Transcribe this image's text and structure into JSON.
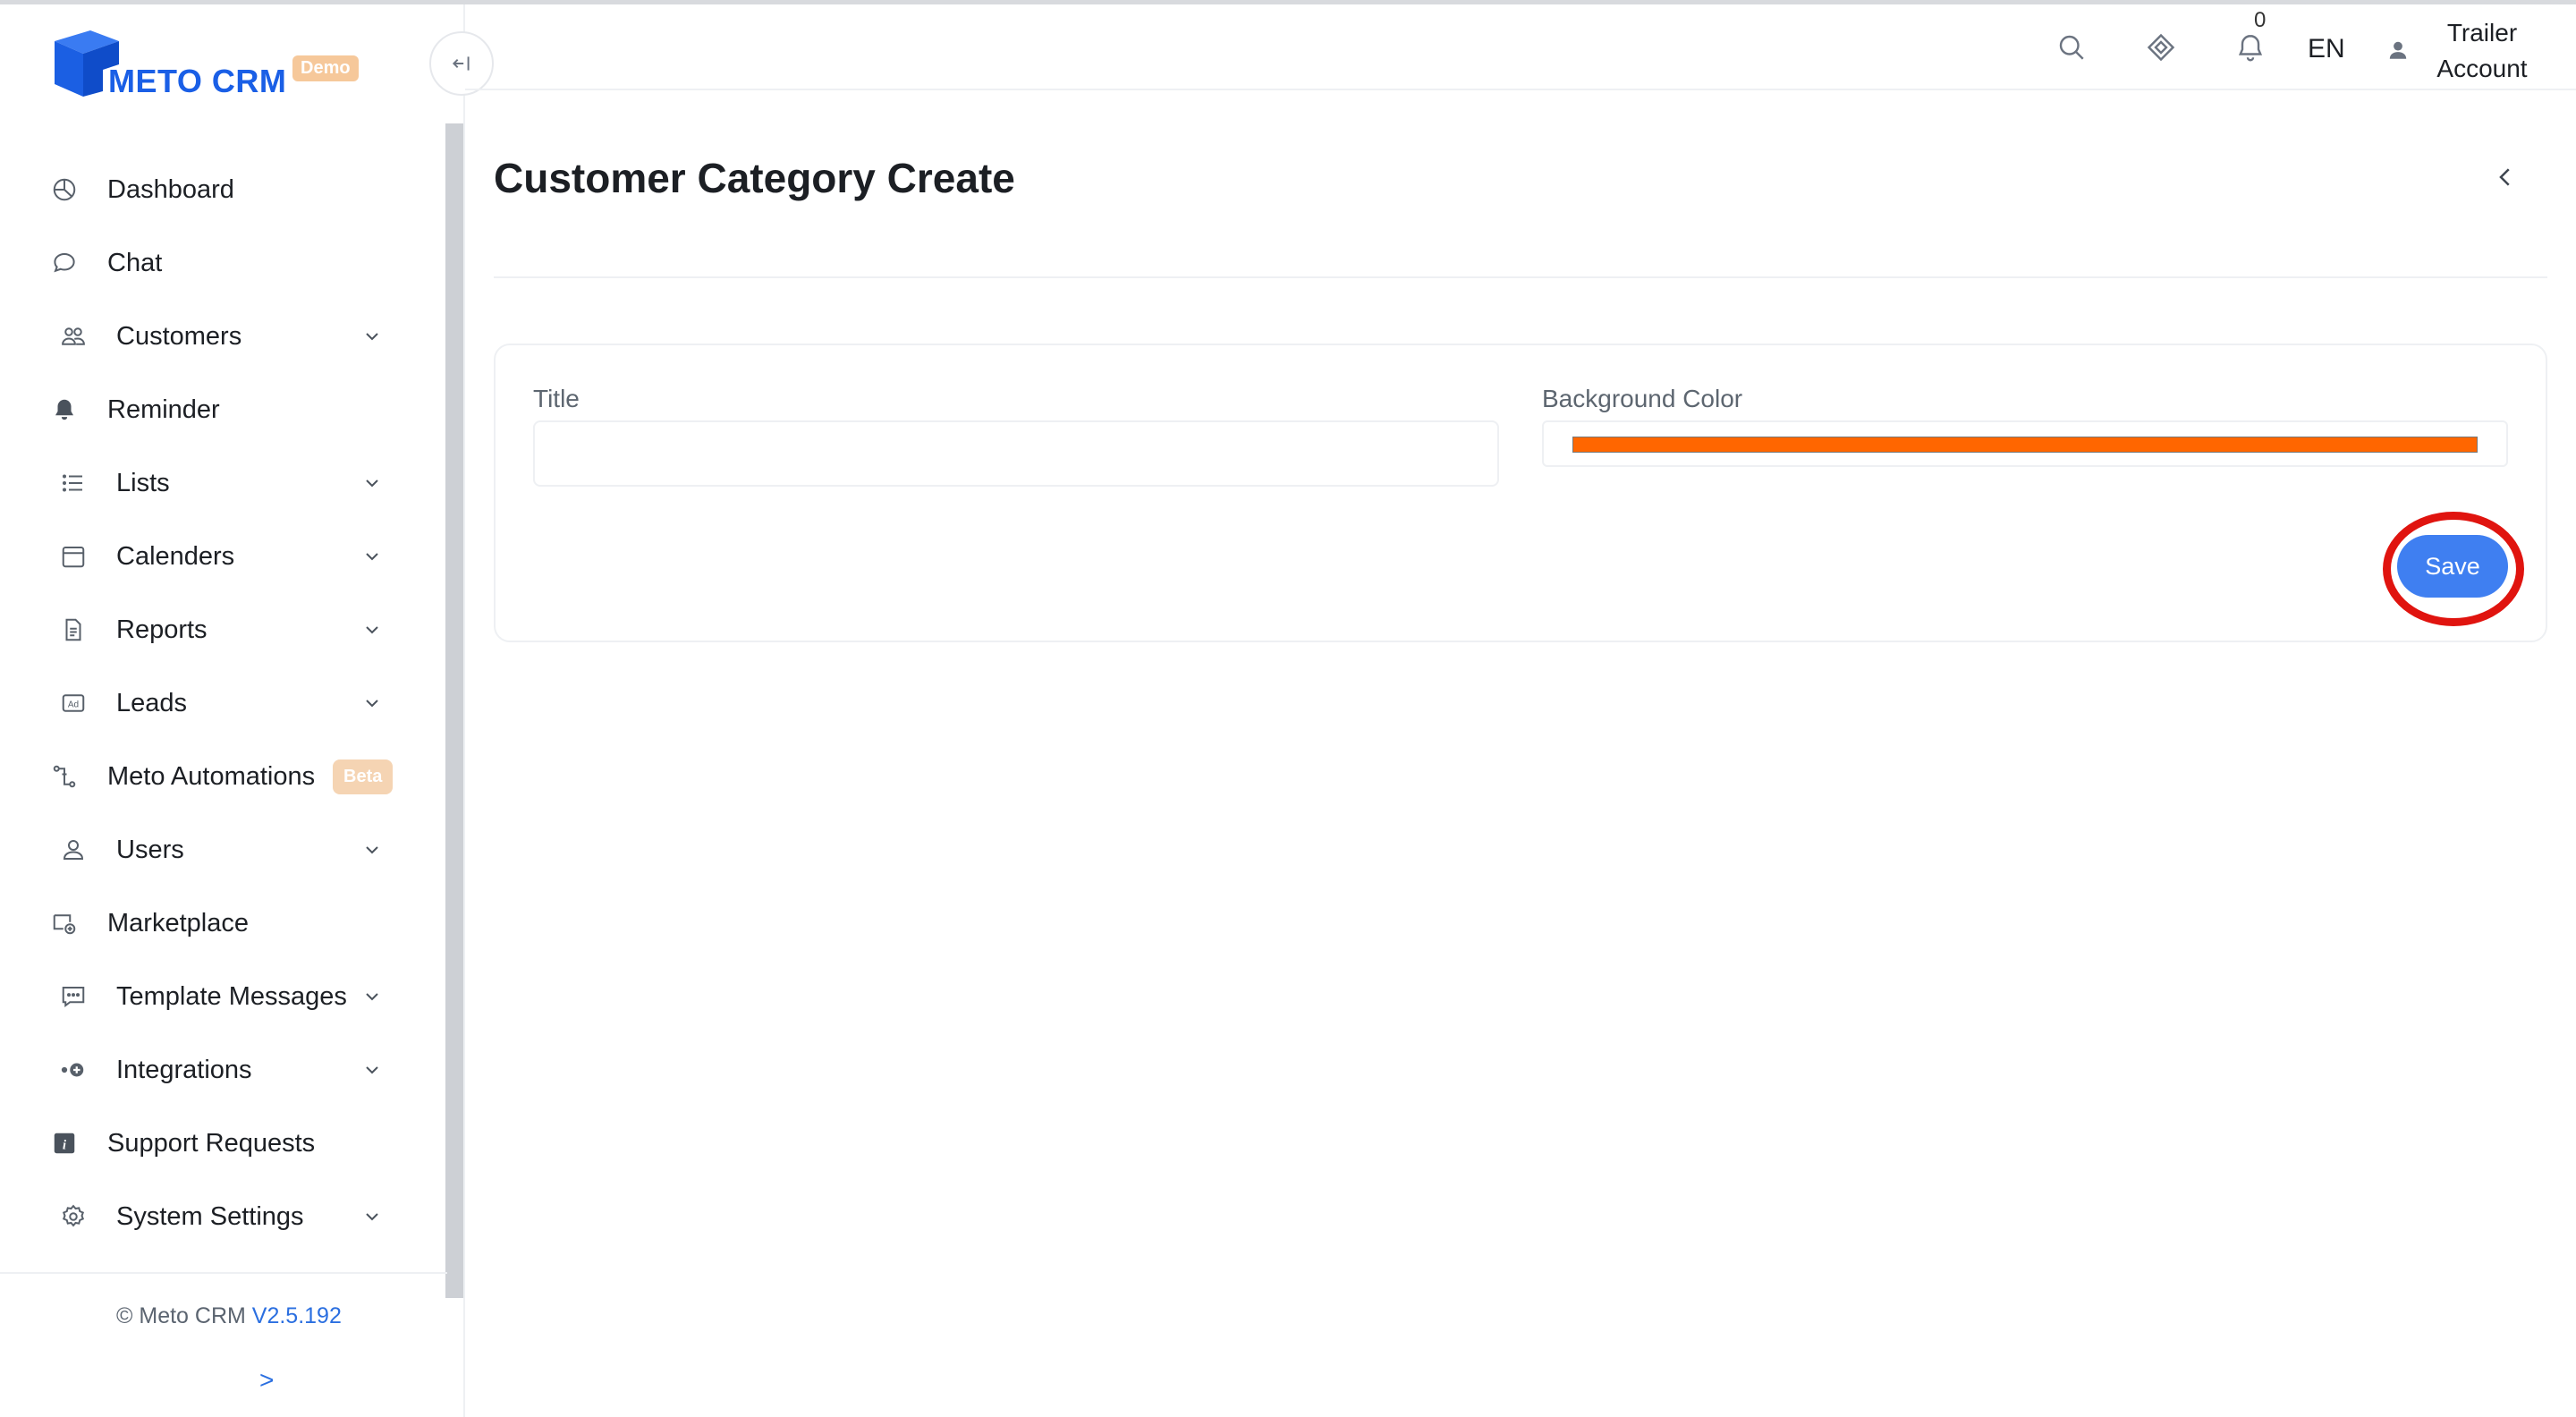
{
  "app": {
    "logo_text": "METO CRM",
    "logo_badge": "Demo",
    "brand_color": "#1a5fe6",
    "accent_color": "#3f7ff1"
  },
  "sidebar": {
    "items": [
      {
        "label": "Dashboard",
        "icon": "pie-chart-icon",
        "has_chevron": false
      },
      {
        "label": "Chat",
        "icon": "chat-bubble-icon",
        "has_chevron": false
      },
      {
        "label": "Customers",
        "icon": "users-icon",
        "has_chevron": true
      },
      {
        "label": "Reminder",
        "icon": "bell-icon",
        "has_chevron": false
      },
      {
        "label": "Lists",
        "icon": "list-icon",
        "has_chevron": true
      },
      {
        "label": "Calenders",
        "icon": "calendar-icon",
        "has_chevron": true
      },
      {
        "label": "Reports",
        "icon": "document-icon",
        "has_chevron": true
      },
      {
        "label": "Leads",
        "icon": "ad-icon",
        "has_chevron": true
      },
      {
        "label": "Meto Automations",
        "icon": "automation-icon",
        "has_chevron": false,
        "badge": "Beta"
      },
      {
        "label": "Users",
        "icon": "user-icon",
        "has_chevron": true
      },
      {
        "label": "Marketplace",
        "icon": "marketplace-icon",
        "has_chevron": false
      },
      {
        "label": "Template Messages",
        "icon": "message-template-icon",
        "has_chevron": true
      },
      {
        "label": "Integrations",
        "icon": "integration-icon",
        "has_chevron": true
      },
      {
        "label": "Support Requests",
        "icon": "info-icon",
        "has_chevron": false
      },
      {
        "label": "System Settings",
        "icon": "gear-icon",
        "has_chevron": true
      }
    ],
    "footer": {
      "copyright": "© Meto CRM",
      "version": "V2.5.192",
      "expand_label": ">"
    }
  },
  "header": {
    "notification_count": "0",
    "language": "EN",
    "user_line1": "Trailer",
    "user_line2": "Account"
  },
  "main": {
    "page_title": "Customer Category Create",
    "form": {
      "title_label": "Title",
      "title_value": "",
      "bg_color_label": "Background Color",
      "bg_color_value": "#ff6600",
      "save_label": "Save"
    },
    "annotation_color": "#e0140f"
  }
}
